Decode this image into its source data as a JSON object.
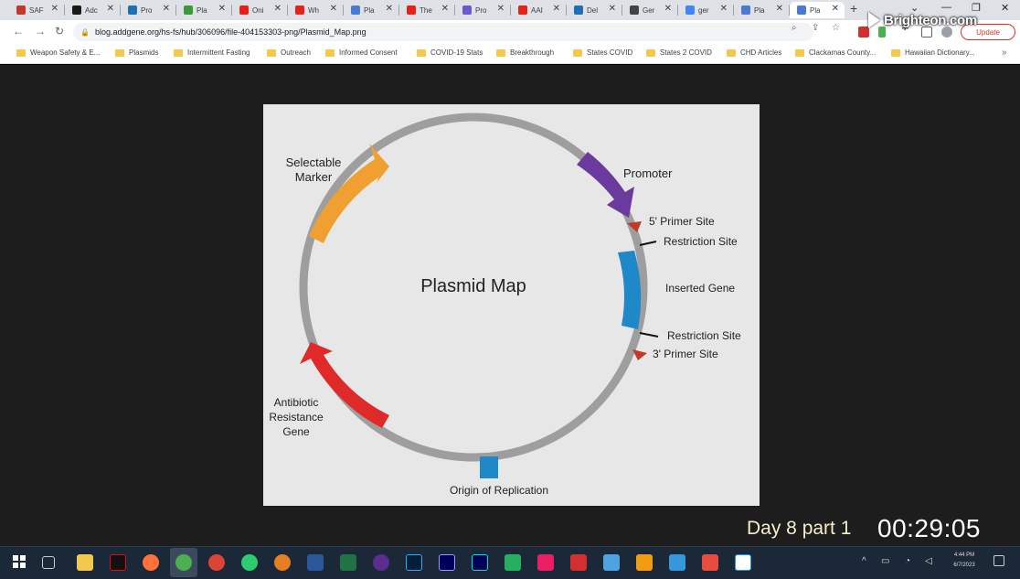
{
  "browser": {
    "tabs": [
      {
        "label": "SAF",
        "favicon_color": "#c0392b"
      },
      {
        "label": "Adc",
        "favicon_color": "#1a1a1a"
      },
      {
        "label": "Pro",
        "favicon_color": "#1f6fb2"
      },
      {
        "label": "Pla",
        "favicon_color": "#3a9a3a"
      },
      {
        "label": "Oni",
        "favicon_color": "#e62117"
      },
      {
        "label": "Wh",
        "favicon_color": "#e62117"
      },
      {
        "label": "Pla",
        "favicon_color": "#4a7bd0"
      },
      {
        "label": "The",
        "favicon_color": "#e62117"
      },
      {
        "label": "Pro",
        "favicon_color": "#6a5acd"
      },
      {
        "label": "AAI",
        "favicon_color": "#e62117"
      },
      {
        "label": "Del",
        "favicon_color": "#1f6fb2"
      },
      {
        "label": "Ger",
        "favicon_color": "#444"
      },
      {
        "label": "ger",
        "favicon_color": "#4285f4"
      },
      {
        "label": "Pla",
        "favicon_color": "#4a7bd0"
      },
      {
        "label": "Pla",
        "favicon_color": "#4a7bd0",
        "active": true
      }
    ],
    "url": "blog.addgene.org/hs-fs/hub/306096/file-404153303-png/Plasmid_Map.png",
    "update_label": "Update",
    "bookmarks": [
      "Weapon Safety & E...",
      "Plasmids",
      "Intermittent Fasting",
      "Outreach",
      "Informed Consent",
      "COVID-19 Stats",
      "Breakthrough",
      "States COVID",
      "States 2 COVID",
      "CHD Articles",
      "Clackamas County...",
      "Hawaiian Dictionary..."
    ],
    "bookmarks_more": "»"
  },
  "overlay": {
    "brand": "Brighteon.com",
    "caption_day": "Day 8 part 1",
    "caption_time": "00:29:05"
  },
  "slide": {
    "title": "Plasmid Map",
    "labels": {
      "selectable_marker": "Selectable\nMarker",
      "promoter": "Promoter",
      "primer5": "5' Primer Site",
      "restriction1": "Restriction Site",
      "inserted_gene": "Inserted Gene",
      "restriction2": "Restriction Site",
      "primer3": "3' Primer Site",
      "antibiotic": "Antibiotic\nResistance\nGene",
      "origin": "Origin of Replication"
    },
    "colors": {
      "backbone": "#9e9e9e",
      "selectable_marker": "#f0a030",
      "promoter": "#6a3a9e",
      "inserted_gene": "#1e88c8",
      "antibiotic": "#e02a2a",
      "origin": "#1e88c8",
      "primer": "#c0392b"
    }
  },
  "taskbar": {
    "clock_time": "4:44 PM",
    "clock_date": "6/7/2023"
  }
}
